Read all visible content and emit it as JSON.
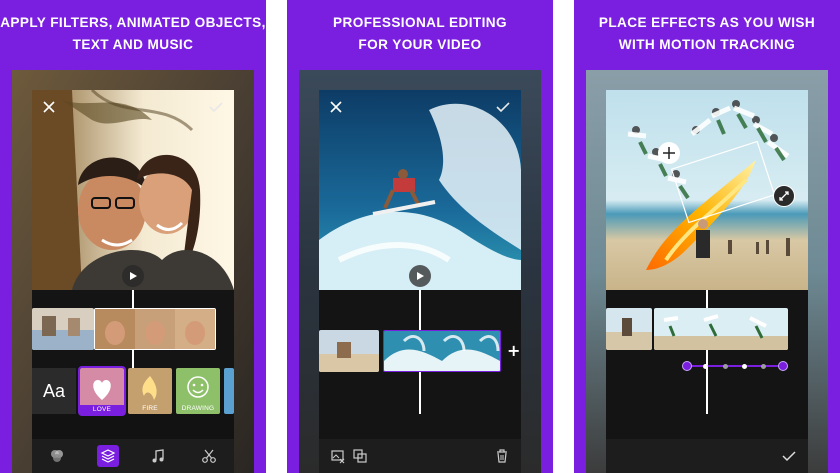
{
  "panels": [
    {
      "caption_line1": "APPLY FILTERS, ANIMATED OBJECTS,",
      "caption_line2": "TEXT AND MUSIC",
      "effects": [
        {
          "label": "Aa"
        },
        {
          "label": "LOVE"
        },
        {
          "label": "FIRE"
        },
        {
          "label": "DRAWING"
        }
      ],
      "toolbar": [
        "filters-icon",
        "layers-icon",
        "music-icon",
        "scissors-icon"
      ],
      "active_tool": "layers-icon"
    },
    {
      "caption_line1": "PROFESSIONAL EDITING",
      "caption_line2": "FOR YOUR VIDEO",
      "add_clip_label": "+",
      "toolbar": [
        "image-settings-icon",
        "duplicate-icon",
        "trash-icon"
      ]
    },
    {
      "caption_line1": "PLACE EFFECTS AS YOU WISH",
      "caption_line2": "WITH MOTION TRACKING",
      "range_start_label": "II",
      "range_end_label": "II",
      "toolbar": [
        "check-icon"
      ]
    }
  ],
  "colors": {
    "accent": "#7a1fe0",
    "screen_bg": "#121212",
    "toolbar_bg": "#1d1d1d",
    "text": "#ffffff"
  }
}
